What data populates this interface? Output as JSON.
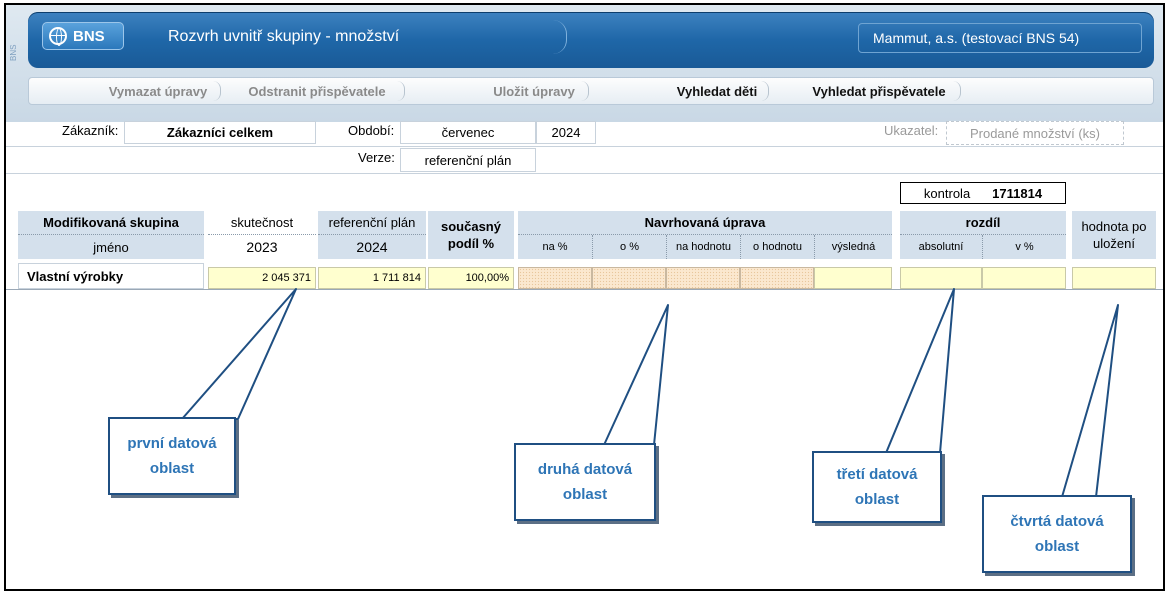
{
  "app": {
    "logo_text": "BNS",
    "side_tag": "BNS",
    "title": "Rozvrh uvnitř skupiny - množství",
    "company": "Mammut, a.s. (testovací BNS 54)"
  },
  "toolbar": {
    "items": [
      {
        "label": "Vymazat úpravy",
        "enabled": false
      },
      {
        "label": "Odstranit přispěvatele",
        "enabled": false
      },
      {
        "label": "Uložit úpravy",
        "enabled": false
      },
      {
        "label": "Vyhledat děti",
        "enabled": true
      },
      {
        "label": "Vyhledat přispěvatele",
        "enabled": true
      }
    ]
  },
  "filters": {
    "customer_label": "Zákazník:",
    "customer_value": "Zákazníci celkem",
    "period_label": "Období:",
    "period_month": "červenec",
    "period_year": "2024",
    "indicator_label": "Ukazatel:",
    "indicator_value": "Prodané množství (ks)",
    "version_label": "Verze:",
    "version_value": "referenční plán"
  },
  "control": {
    "label": "kontrola",
    "value": "1711814"
  },
  "table": {
    "group_header": "Modifikovaná skupina",
    "group_sub": "jméno",
    "actual_header": "skutečnost",
    "actual_year": "2023",
    "plan_header": "referenční plán",
    "plan_year": "2024",
    "share_header": "současný podíl %",
    "proposed_header": "Navrhovaná úprava",
    "proposed_cols": [
      "na %",
      "o %",
      "na hodnotu",
      "o hodnotu",
      "výsledná"
    ],
    "diff_header": "rozdíl",
    "diff_cols": [
      "absolutní",
      "v %"
    ],
    "saved_header": "hodnota po uložení",
    "rows": [
      {
        "name": "Vlastní výrobky",
        "actual": "2 045 371",
        "plan": "1 711 814",
        "share": "100,00%"
      }
    ]
  },
  "callouts": {
    "first": [
      "první datová",
      "oblast"
    ],
    "second": [
      "druhá datová",
      "oblast"
    ],
    "third": [
      "třetí datová",
      "oblast"
    ],
    "fourth": [
      "čtvrtá datová",
      "oblast"
    ]
  },
  "colors": {
    "title_blue": "#1f67a8",
    "header_bg": "#d4e0ec",
    "input_yellow": "#ffffcf",
    "callout_text": "#2e75b6",
    "callout_border": "#1f4f82"
  }
}
